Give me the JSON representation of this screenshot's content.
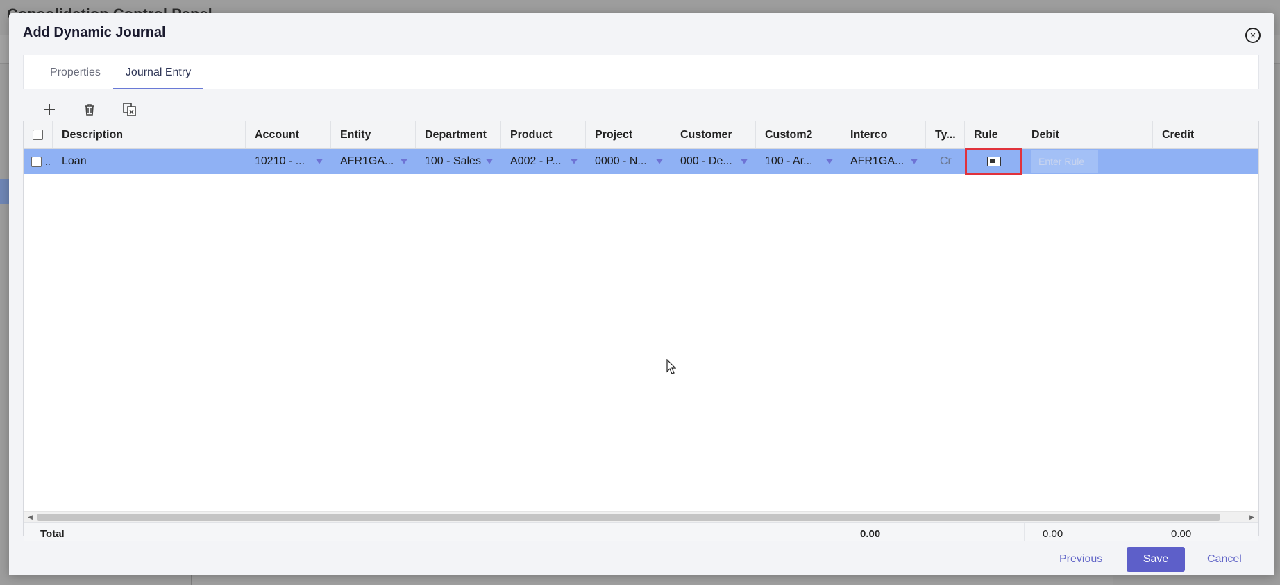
{
  "background": {
    "title": "Consolidation Control Panel"
  },
  "modal": {
    "title": "Add Dynamic Journal",
    "close_icon": "close-circle-icon"
  },
  "tabs": [
    {
      "label": "Properties",
      "active": false
    },
    {
      "label": "Journal Entry",
      "active": true
    }
  ],
  "toolbar": {
    "add_icon": "plus-icon",
    "delete_icon": "trash-icon",
    "copy_icon": "copy-icon"
  },
  "grid": {
    "columns": [
      "Description",
      "Account",
      "Entity",
      "Department",
      "Product",
      "Project",
      "Customer",
      "Custom2",
      "Interco",
      "Ty...",
      "Rule",
      "Debit",
      "Credit"
    ],
    "row": {
      "marker": "..",
      "description": "Loan",
      "account": "10210 - ...",
      "entity": "AFR1GA...",
      "department": "100 - Sales",
      "product": "A002 - P...",
      "project": "0000 - N...",
      "customer": "000 - De...",
      "custom2": "100 - Ar...",
      "interco": "AFR1GA...",
      "type": "Cr",
      "rule_icon": "rule-editor-icon",
      "debit_placeholder": "Enter Rule",
      "credit": ""
    },
    "total": {
      "label": "Total",
      "interco_total": "0.00",
      "debit_total": "0.00",
      "credit_total": "0.00"
    }
  },
  "footer": {
    "previous": "Previous",
    "save": "Save",
    "cancel": "Cancel"
  },
  "colors": {
    "selected_row": "#8fb1f4",
    "primary_button": "#5d5fc9",
    "rule_highlight": "#e0323c",
    "link": "#6367c8"
  }
}
